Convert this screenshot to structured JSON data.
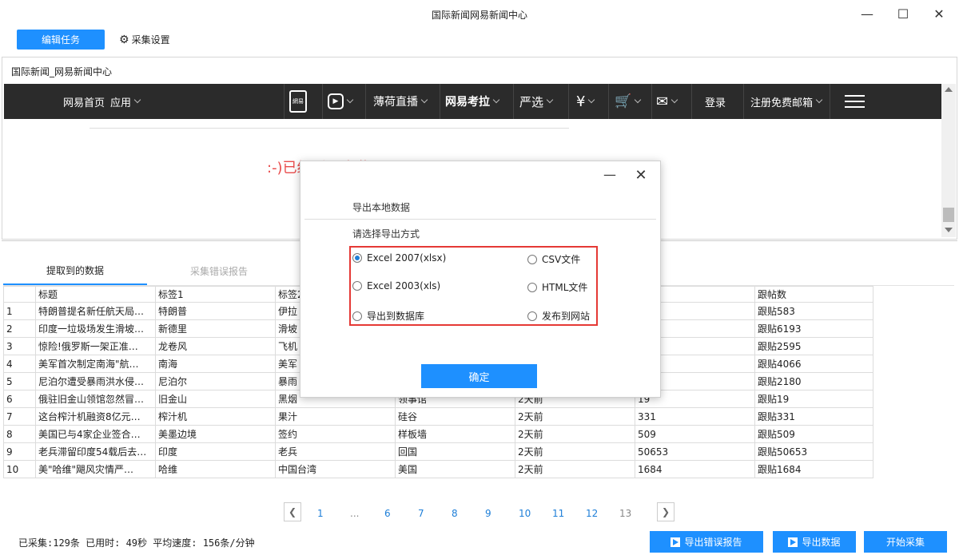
{
  "window": {
    "title": "国际新闻网易新闻中心"
  },
  "toolbar": {
    "edit_task": "编辑任务",
    "settings": "采集设置"
  },
  "browser": {
    "page_title": "国际新闻_网易新闻中心",
    "nav": {
      "home": "网易首页",
      "apps": "应用",
      "brand_small": "網易",
      "bohe": "薄荷直播",
      "kaola": "网易考拉",
      "yanxuan": "严选",
      "login": "登录",
      "register": "注册免费邮箱"
    },
    "red_text": ":-)已经到尽头啦"
  },
  "tabs": {
    "extracted": "提取到的数据",
    "errors": "采集错误报告"
  },
  "table": {
    "headers": [
      "",
      "标题",
      "标签1",
      "标签2",
      "",
      "",
      "",
      "跟帖数"
    ],
    "header_col7": "跟帖",
    "rows": [
      [
        "1",
        "特朗普提名新任航天局…",
        "特朗普",
        "伊拉",
        "",
        "",
        "",
        "跟贴583"
      ],
      [
        "2",
        "印度一垃圾场发生滑坡…",
        "新德里",
        "滑坡",
        "",
        "",
        "",
        "跟贴6193"
      ],
      [
        "3",
        "惊险!俄罗斯一架正准…",
        "龙卷风",
        "飞机",
        "",
        "",
        "",
        "跟贴2595"
      ],
      [
        "4",
        "美军首次制定南海\"航…",
        "南海",
        "美军",
        "",
        "",
        "",
        "跟贴4066"
      ],
      [
        "5",
        "尼泊尔遭受暴雨洪水侵…",
        "尼泊尔",
        "暴雨",
        "",
        "",
        "",
        "跟贴2180"
      ],
      [
        "6",
        "俄驻旧金山领馆忽然冒…",
        "旧金山",
        "黑烟",
        "领事馆",
        "2天前",
        "19",
        "跟贴19"
      ],
      [
        "7",
        "这台榨汁机融资8亿元…",
        "榨汁机",
        "果汁",
        "硅谷",
        "2天前",
        "331",
        "跟贴331"
      ],
      [
        "8",
        "美国已与4家企业签合…",
        "美墨边境",
        "签约",
        "样板墙",
        "2天前",
        "509",
        "跟贴509"
      ],
      [
        "9",
        "老兵滞留印度54载后去…",
        "印度",
        "老兵",
        "回国",
        "2天前",
        "50653",
        "跟贴50653"
      ],
      [
        "10",
        "美\"哈维\"飓风灾情严…",
        "哈维",
        "中国台湾",
        "美国",
        "2天前",
        "1684",
        "跟贴1684"
      ]
    ]
  },
  "pagination": {
    "pages": [
      "1",
      "...",
      "6",
      "7",
      "8",
      "9",
      "10",
      "11",
      "12",
      "13"
    ],
    "current": "13"
  },
  "status": {
    "text": "已采集:129条  已用时: 49秒  平均速度: 156条/分钟"
  },
  "buttons": {
    "export_errors": "导出错误报告",
    "export_data": "导出数据",
    "start": "开始采集"
  },
  "dialog": {
    "heading": "导出本地数据",
    "subheading": "请选择导出方式",
    "options": [
      "Excel 2007(xlsx)",
      "CSV文件",
      "Excel 2003(xls)",
      "HTML文件",
      "导出到数据库",
      "发布到网站"
    ],
    "selected": "Excel 2007(xlsx)",
    "ok": "确定"
  },
  "colors": {
    "accent": "#1e90ff",
    "highlight_border": "#e53935",
    "nav_bg": "#2b2b2b",
    "red_text": "#e94c4c"
  }
}
